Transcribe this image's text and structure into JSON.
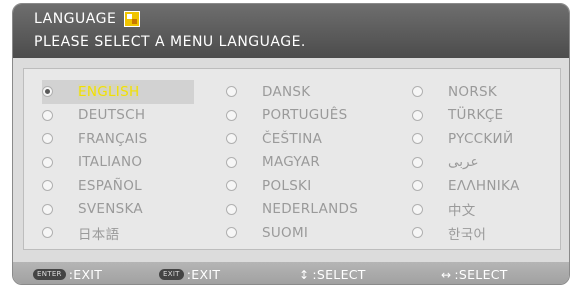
{
  "header": {
    "title": "LANGUAGE",
    "subtitle": "PLEASE SELECT A MENU LANGUAGE."
  },
  "languages": {
    "col1": [
      "ENGLISH",
      "DEUTSCH",
      "FRANÇAIS",
      "ITALIANO",
      "ESPAÑOL",
      "SVENSKA",
      "日本語"
    ],
    "col2": [
      "DANSK",
      "PORTUGUÊS",
      "ČEŠTINA",
      "MAGYAR",
      "POLSKI",
      "NEDERLANDS",
      "SUOMI"
    ],
    "col3": [
      "NORSK",
      "TÜRKÇE",
      "PYCCKИЙ",
      "عربى",
      "ΕΛΛΗΝΙΚΑ",
      "中文",
      "한국어"
    ],
    "selected": "ENGLISH"
  },
  "footer": {
    "enter_key": "ENTER",
    "enter_label": ":EXIT",
    "exit_key": "EXIT",
    "exit_label": ":EXIT",
    "updown_symbol": "↕",
    "updown_label": ":SELECT",
    "leftright_symbol": "↔",
    "leftright_label": ":SELECT"
  },
  "colors": {
    "highlight_text": "#f2e100",
    "header_bg": "#5a5a5a"
  }
}
